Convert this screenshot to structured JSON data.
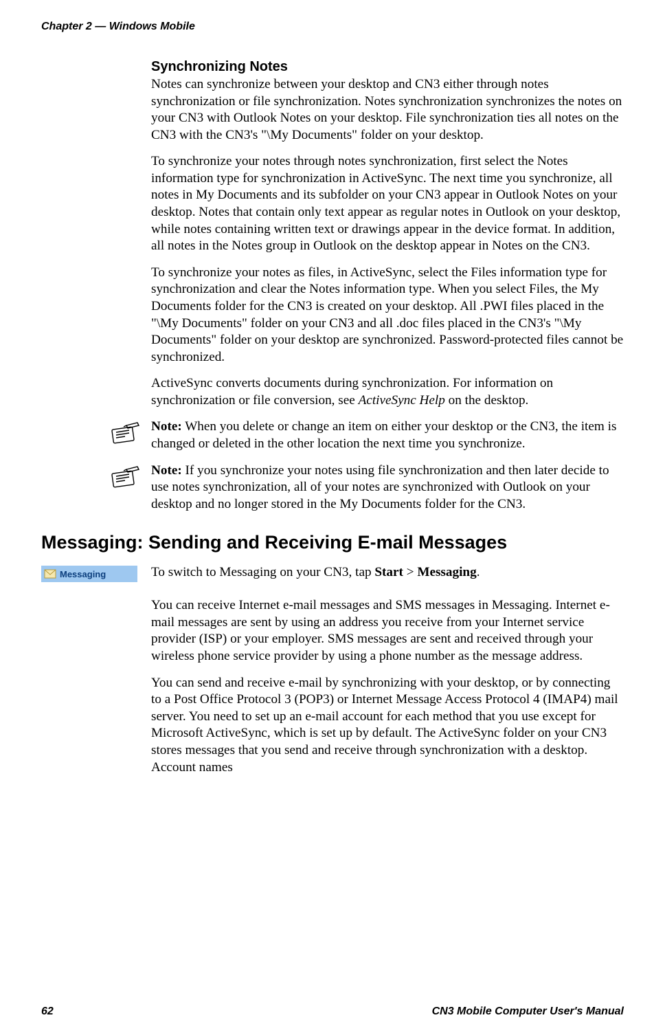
{
  "header": {
    "chapter": "Chapter 2 — Windows Mobile"
  },
  "sections": {
    "syncNotes": {
      "heading": "Synchronizing Notes",
      "p1": "Notes can synchronize between your desktop and CN3 either through notes synchronization or file synchronization. Notes synchronization synchronizes the notes on your CN3 with Outlook Notes on your desktop. File synchronization ties all notes on the CN3 with the CN3's \"\\My Documents\" folder on your desktop.",
      "p2": "To synchronize your notes through notes synchronization, first select the Notes information type for synchronization in ActiveSync. The next time you synchronize, all notes in My Documents and its subfolder on your CN3 appear in Outlook Notes on your desktop. Notes that contain only text appear as regular notes in Outlook on your desktop, while notes containing written text or drawings appear in the device format. In addition, all notes in the Notes group in Outlook on the desktop appear in Notes on the CN3.",
      "p3": "To synchronize your notes as files, in ActiveSync, select the Files information type for synchronization and clear the Notes information type. When you select Files, the My Documents folder for the CN3 is created on your desktop. All .PWI files placed in the \"\\My Documents\" folder on your CN3 and all .doc files placed in the CN3's \"\\My Documents\" folder on your desktop are synchronized. Password-protected files cannot be synchronized.",
      "p4a": "ActiveSync converts documents during synchronization. For information on synchronization or file conversion, see ",
      "p4italic": "ActiveSync Help",
      "p4b": " on the desktop.",
      "note1label": "Note:",
      "note1text": " When you delete or change an item on either your desktop or the CN3, the item is changed or deleted in the other location the next time you synchronize.",
      "note2label": "Note:",
      "note2text": " If you synchronize your notes using file synchronization and then later decide to use notes synchronization, all of your notes are synchronized with Outlook on your desktop and no longer stored in the My Documents folder for the CN3."
    },
    "messaging": {
      "heading": "Messaging: Sending and Receiving E-mail Messages",
      "pillLabel": "Messaging",
      "intro_a": "To switch to Messaging on your CN3, tap ",
      "intro_start": "Start",
      "intro_gt": " > ",
      "intro_messaging": "Messaging",
      "intro_end": ".",
      "p1": "You can receive Internet e-mail messages and SMS messages in Messaging. Internet e-mail messages are sent by using an address you receive from your Internet service provider (ISP) or your employer. SMS messages are sent and received through your wireless phone service provider by using a phone number as the message address.",
      "p2": "You can send and receive e-mail by synchronizing with your desktop, or by connecting to a Post Office Protocol 3 (POP3) or Internet Message Access Protocol 4 (IMAP4) mail server. You need to set up an e-mail account for each method that you use except for Microsoft ActiveSync, which is set up by default. The ActiveSync folder on your CN3 stores messages that you send and receive through synchronization with a desktop. Account names"
    }
  },
  "footer": {
    "pageNum": "62",
    "manual": "CN3 Mobile Computer User's Manual"
  }
}
